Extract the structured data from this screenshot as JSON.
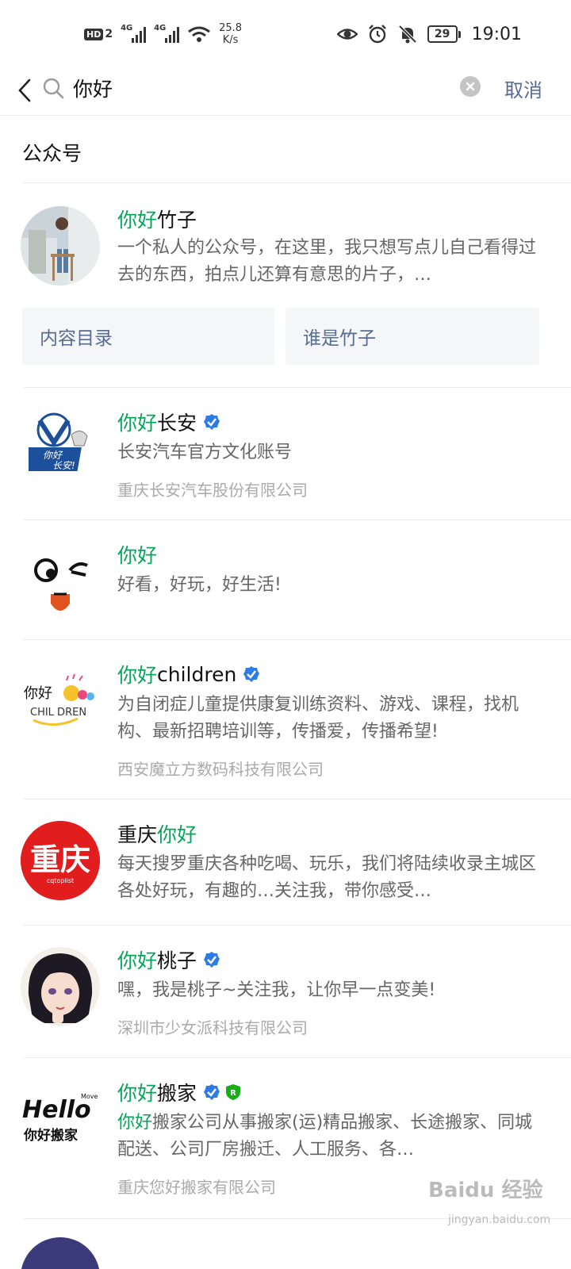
{
  "status_bar": {
    "hd_label": "HD",
    "hd_number": "2",
    "sim1_tag": "4G",
    "sim2_tag": "4G",
    "net_speed_value": "25.8",
    "net_speed_unit": "K/s",
    "battery": "29",
    "time": "19:01"
  },
  "search": {
    "query": "你好",
    "cancel_label": "取消"
  },
  "section": {
    "title": "公众号"
  },
  "results": [
    {
      "title_highlight": "你好",
      "title_rest": "竹子",
      "desc": "一个私人的公众号，在这里，我只想写点儿自己看得过去的东西，拍点儿还算有意思的片子，…",
      "menu": [
        "内容目录",
        "谁是竹子"
      ]
    },
    {
      "title_highlight": "你好",
      "title_rest": "长安",
      "verified": true,
      "desc": "长安汽车官方文化账号",
      "owner": "重庆长安汽车股份有限公司",
      "avatar_text_top": "你好",
      "avatar_text_bottom": "长安!"
    },
    {
      "title_highlight": "你好",
      "title_rest": "",
      "desc": "好看，好玩，好生活!"
    },
    {
      "title_highlight": "你好",
      "title_rest": "children",
      "verified": true,
      "desc": "为自闭症儿童提供康复训练资料、游戏、课程，找机构、最新招聘培训等，传播爱，传播希望!",
      "owner": "西安魔立方数码科技有限公司",
      "avatar_text_top": "你好",
      "avatar_text_bottom": "CHIL DREN"
    },
    {
      "title_prefix": "重庆",
      "title_highlight": "你好",
      "desc": "每天搜罗重庆各种吃喝、玩乐，我们将陆续收录主城区各处好玩，有趣的…关注我，带你感受…",
      "avatar_text": "重庆",
      "avatar_subtext": "cqtoplist"
    },
    {
      "title_highlight": "你好",
      "title_rest": "桃子",
      "verified": true,
      "desc": "嘿，我是桃子~关注我，让你早一点变美!",
      "owner": "深圳市少女派科技有限公司"
    },
    {
      "title_highlight": "你好",
      "title_rest": "搬家",
      "verified": true,
      "registered": true,
      "desc_highlight": "你好",
      "desc_rest": "搬家公司从事搬家(运)精品搬家、长途搬家、同城配送、公司厂房搬迁、人工服务、各…",
      "owner": "重庆您好搬家有限公司",
      "avatar_text_top": "Hello",
      "avatar_text_move": "Move",
      "avatar_text_bottom": "你好搬家"
    }
  ],
  "watermark": {
    "text": "Baidu 经验",
    "sub": "jingyan.baidu.com"
  },
  "colors": {
    "highlight": "#07a55a",
    "link": "#576b95",
    "verified": "#2f7be5",
    "registered": "#1aad19"
  }
}
